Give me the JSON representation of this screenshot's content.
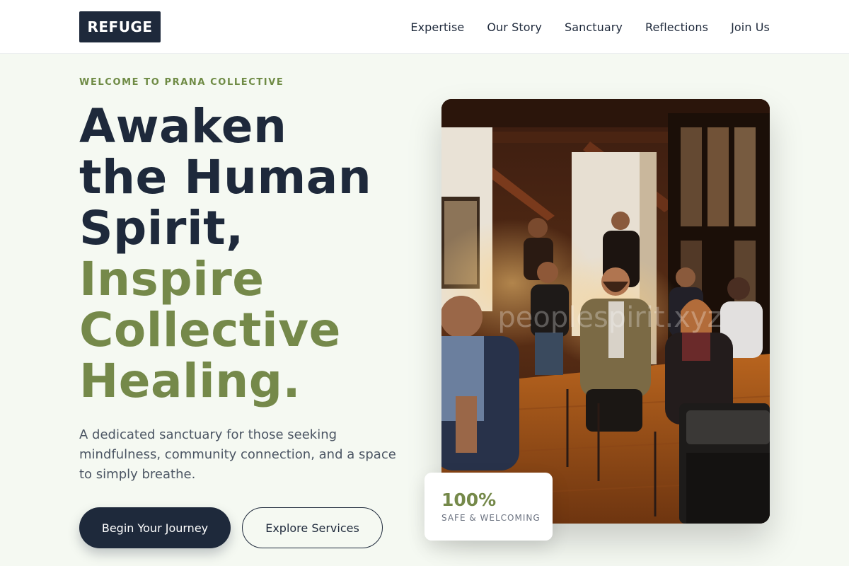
{
  "header": {
    "logo": "REFUGE",
    "nav": [
      "Expertise",
      "Our Story",
      "Sanctuary",
      "Reflections",
      "Join Us"
    ]
  },
  "hero": {
    "eyebrow": "WELCOME TO PRANA COLLECTIVE",
    "headline_dark": [
      "Awaken",
      "the Human",
      "Spirit,"
    ],
    "headline_green": [
      "Inspire",
      "Collective",
      "Healing."
    ],
    "subtext": "A dedicated sanctuary for those seeking mindfulness, community connection, and a space to simply breathe.",
    "primary_button": "Begin Your Journey",
    "secondary_button": "Explore Services"
  },
  "photo": {
    "watermark": "peoplespirit.xyz"
  },
  "stat": {
    "value": "100%",
    "label": "SAFE & WELCOMING"
  },
  "colors": {
    "navy": "#1e293b",
    "olive_green": "#75894a",
    "background": "#f5f9f2"
  }
}
